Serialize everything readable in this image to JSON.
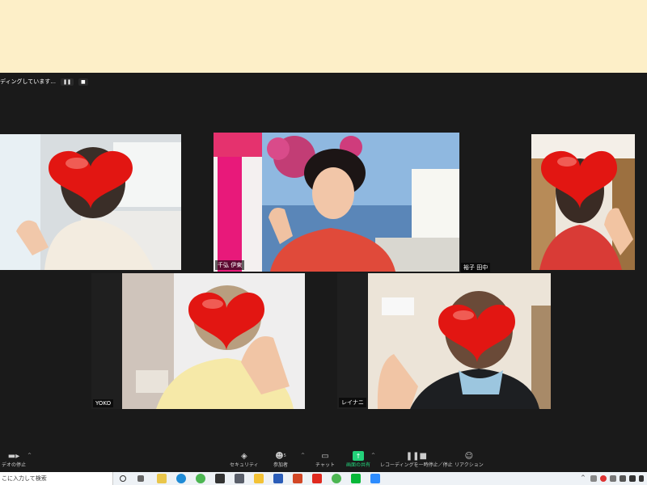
{
  "recording": {
    "status": "ディングしています...",
    "pause_icon": "pause-icon",
    "stop_icon": "stop-icon"
  },
  "participants": [
    {
      "name": ""
    },
    {
      "name": "千弘 伊東"
    },
    {
      "name": "裕子 田中"
    },
    {
      "name": "YOKO"
    },
    {
      "name": "レイナニ"
    }
  ],
  "toolbar": {
    "video_label": "デオの停止",
    "security_label": "セキュリティ",
    "participants_label": "参加者",
    "participants_count": "5",
    "chat_label": "チャット",
    "share_label": "画面の共有",
    "recording_label": "レコーディングを一時停止／停止",
    "reaction_label": "リアクション"
  },
  "taskbar": {
    "search_placeholder": "こに入力して検索"
  },
  "colors": {
    "active_speaker": "#c8e64a",
    "share_green": "#23d17a",
    "top_band": "#fdefc8"
  }
}
